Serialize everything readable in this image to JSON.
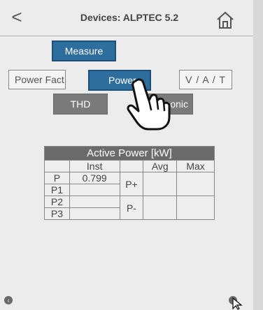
{
  "header": {
    "title": "Devices: ALPTEC 5.2",
    "back_glyph": "<",
    "back_icon": "chevron-left-icon",
    "home_icon": "home-icon"
  },
  "tabs": {
    "measure": "Measure"
  },
  "buttons": {
    "power_fact": "Power Fact",
    "power": "Power",
    "vat": "V / A / T",
    "thd": "THD",
    "harmonic": "Harmonic"
  },
  "table": {
    "title": "Active Power [kW]",
    "columns": [
      "Inst",
      "Avg",
      "Max"
    ],
    "rows": [
      {
        "label": "P",
        "inst": "0.799"
      },
      {
        "label": "P1",
        "inst": ""
      },
      {
        "label": "P2",
        "inst": ""
      },
      {
        "label": "P3",
        "inst": ""
      }
    ],
    "group_plus": "P+",
    "group_minus": "P-"
  },
  "colors": {
    "accent": "#2e6e9e",
    "gray_button": "#7a7a7a",
    "header_row": "#6b6b6b"
  }
}
